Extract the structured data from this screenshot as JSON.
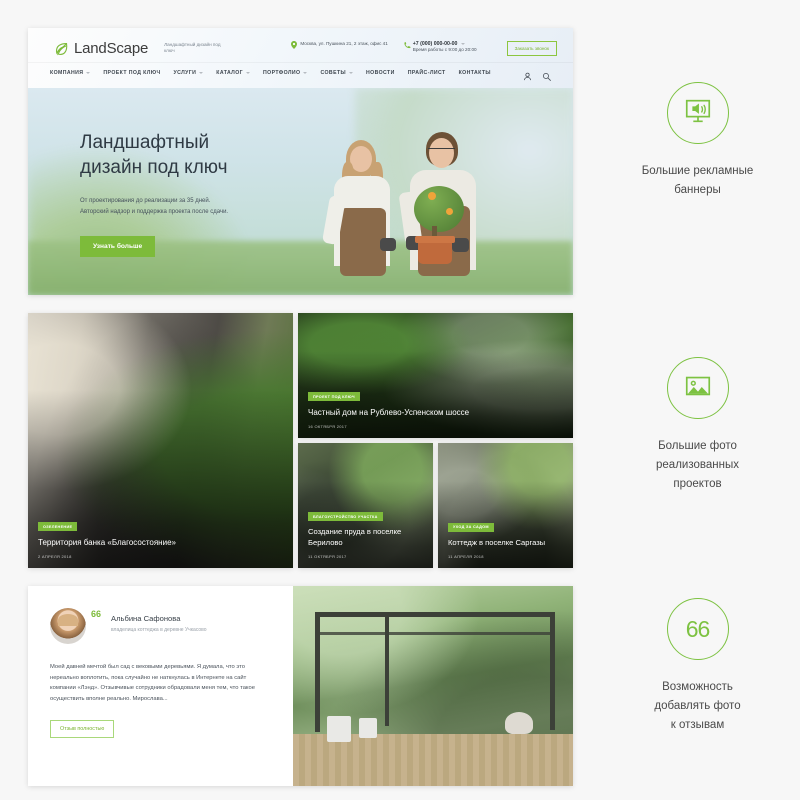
{
  "site": {
    "logo_text": "LandScape",
    "logo_icon": "leaf-icon",
    "tagline": "Ландшафтный дизайн под ключ",
    "address": "Москва, ул. Пушкина 21, 2 этаж, офис 41",
    "phone": "+7 (000) 000-00-00",
    "work_hours": "Время работы с 9:00 до 20:00",
    "callback_label": "Заказать звонок"
  },
  "nav": {
    "items": [
      {
        "label": "КОМПАНИЯ",
        "has_caret": true
      },
      {
        "label": "ПРОЕКТ ПОД КЛЮЧ",
        "has_caret": false
      },
      {
        "label": "УСЛУГИ",
        "has_caret": true
      },
      {
        "label": "КАТАЛОГ",
        "has_caret": true
      },
      {
        "label": "ПОРТФОЛИО",
        "has_caret": true
      },
      {
        "label": "СОВЕТЫ",
        "has_caret": true
      },
      {
        "label": "НОВОСТИ",
        "has_caret": false
      },
      {
        "label": "ПРАЙС-ЛИСТ",
        "has_caret": false
      },
      {
        "label": "КОНТАКТЫ",
        "has_caret": false
      }
    ],
    "icons": [
      "user-icon",
      "search-icon"
    ]
  },
  "hero": {
    "title_line1": "Ландшафтный",
    "title_line2": "дизайн под ключ",
    "sub_line1": "От проектирования до реализации за 35 дней.",
    "sub_line2": "Авторский надзор и поддержка проекта  после сдачи.",
    "button_label": "Узнать больше"
  },
  "portfolio": {
    "main": {
      "badge": "ОЗЕЛЕНЕНИЕ",
      "title": "Территория банка «Благосостояние»",
      "date": "2 АПРЕЛЯ 2018"
    },
    "big": {
      "badge": "ПРОЕКТ ПОД КЛЮЧ",
      "title": "Частный дом на Рублево-Успенском шоссе",
      "date": "16 ОКТЯБРЯ 2017"
    },
    "small": [
      {
        "badge": "БЛАГОУСТРОЙСТВО УЧАСТКА",
        "title": "Создание пруда в поселке Берилово",
        "date": "11 ОКТЯБРЯ 2017"
      },
      {
        "badge": "УХОД ЗА САДОМ",
        "title": "Коттедж в поселке Саргазы",
        "date": "11 АПРЕЛЯ 2018"
      }
    ]
  },
  "review": {
    "quote_mark": "66",
    "author_name": "Альбина Сафонова",
    "author_role": "владелица коттеджа в деревне Учкасово",
    "text": "Моей давней мечтой был сад с вековыми деревьями. Я думала, что это нереально воплотить, пока случайно не наткнулась в Интернете на сайт компании «Лэнд». Отзывчивые сотрудники обрадовали меня тем, что такое осуществить вполне реально. Мирослава...",
    "button_label": "Отзыв полностью"
  },
  "features": [
    {
      "icon": "billboard-icon",
      "label_line1": "Большие рекламные",
      "label_line2": "баннеры"
    },
    {
      "icon": "image-icon",
      "label_line1": "Большие фото",
      "label_line2": "реализованных",
      "label_line3": "проектов"
    },
    {
      "icon": "quote-icon",
      "quote_text": "66",
      "label_line1": "Возможность",
      "label_line2": "добавлять фото",
      "label_line3": "к отзывам"
    }
  ],
  "colors": {
    "accent_green": "#7dbb3a",
    "circle_green": "#7dc242",
    "text_dark": "#3b434b"
  }
}
